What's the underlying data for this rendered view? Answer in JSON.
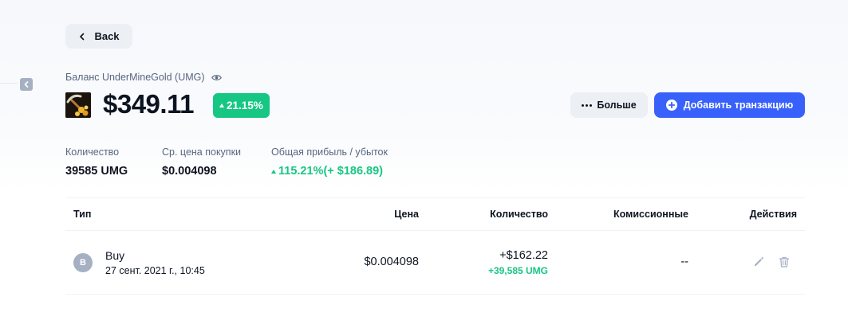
{
  "back": {
    "label": "Back",
    "icon": "chevron-left-icon"
  },
  "balance": {
    "label": "Баланс UnderMineGold (UMG)",
    "amount": "$349.11",
    "change": "21.15%",
    "change_direction": "up"
  },
  "actions": {
    "more_label": "Больше",
    "add_label": "Добавить транзакцию"
  },
  "stats": [
    {
      "label": "Количество",
      "value": "39585 UMG"
    },
    {
      "label": "Ср. цена покупки",
      "value": "$0.004098"
    },
    {
      "label": "Общая прибыль / убыток",
      "value": "115.21%(+ $186.89)"
    }
  ],
  "table": {
    "columns": [
      "Тип",
      "Цена",
      "Количество",
      "Комиссионные",
      "Действия"
    ],
    "rows": [
      {
        "badge": "B",
        "type": "Buy",
        "date": "27 сент. 2021 г., 10:45",
        "price": "$0.004098",
        "quantity_usd": "+$162.22",
        "quantity_coin": "+39,585 UMG",
        "fees": "--"
      }
    ]
  },
  "colors": {
    "accent": "#3861fb",
    "positive": "#16c784",
    "muted": "#58667e",
    "button_bg": "#eceff4"
  }
}
